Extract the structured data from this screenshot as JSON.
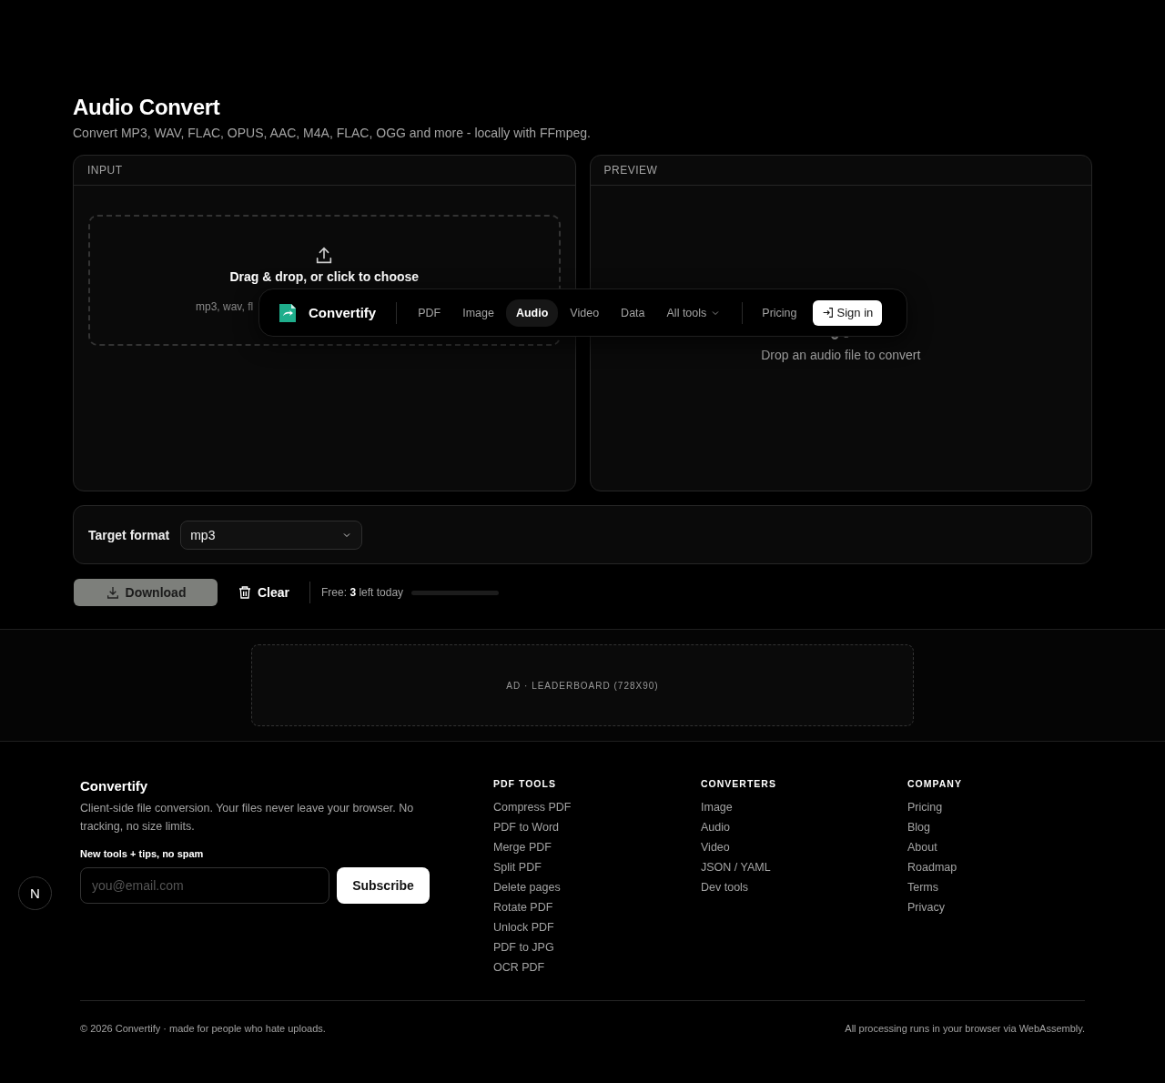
{
  "page": {
    "title": "Audio Convert",
    "subtitle": "Convert MP3, WAV, FLAC, OPUS, AAC, M4A, FLAC, OGG and more - locally with FFmpeg."
  },
  "input_panel": {
    "header": "INPUT",
    "dropzone": {
      "title": "Drag & drop, or click to choose",
      "hint": "mp3, wav, fl"
    }
  },
  "preview_panel": {
    "header": "PREVIEW",
    "empty_text": "Drop an audio file to convert"
  },
  "nav": {
    "brand": "Convertify",
    "items": [
      {
        "label": "PDF",
        "selected": false,
        "kind": "link"
      },
      {
        "label": "Image",
        "selected": false,
        "kind": "link"
      },
      {
        "label": "Audio",
        "selected": true,
        "kind": "link"
      },
      {
        "label": "Video",
        "selected": false,
        "kind": "link"
      },
      {
        "label": "Data",
        "selected": false,
        "kind": "link"
      },
      {
        "label": "All tools",
        "selected": false,
        "kind": "menu"
      }
    ],
    "pricing": "Pricing",
    "sign_in": "Sign in"
  },
  "format": {
    "label": "Target format",
    "value": "mp3"
  },
  "actions": {
    "download": {
      "label": "Download",
      "disabled": true
    },
    "clear": "Clear",
    "quota": "Free: **3** left today",
    "level": 0
  },
  "ad": {
    "text": "AD · LEADERBOARD (728X90)"
  },
  "footer": {
    "brand": "Convertify",
    "about": "Client-side file conversion. Your files never leave your browser. No tracking, no size limits.",
    "newsletter_label": "New tools + tips, no spam",
    "email_placeholder": "you@email.com",
    "subscribe": "Subscribe",
    "columns": [
      {
        "heading": "PDF TOOLS",
        "links": [
          "Compress PDF",
          "PDF to Word",
          "Merge PDF",
          "Split PDF",
          "Delete pages",
          "Rotate PDF",
          "Unlock PDF",
          "PDF to JPG",
          "OCR PDF"
        ]
      },
      {
        "heading": "CONVERTERS",
        "links": [
          "Image",
          "Audio",
          "Video",
          "JSON / YAML",
          "Dev tools"
        ]
      },
      {
        "heading": "COMPANY",
        "links": [
          "Pricing",
          "Blog",
          "About",
          "Roadmap",
          "Terms",
          "Privacy"
        ]
      }
    ],
    "copyright": "© 2026 Convertify · made for people who hate uploads.",
    "note": "All processing runs in your browser via WebAssembly."
  },
  "dev_badge": {
    "letter": "N"
  }
}
